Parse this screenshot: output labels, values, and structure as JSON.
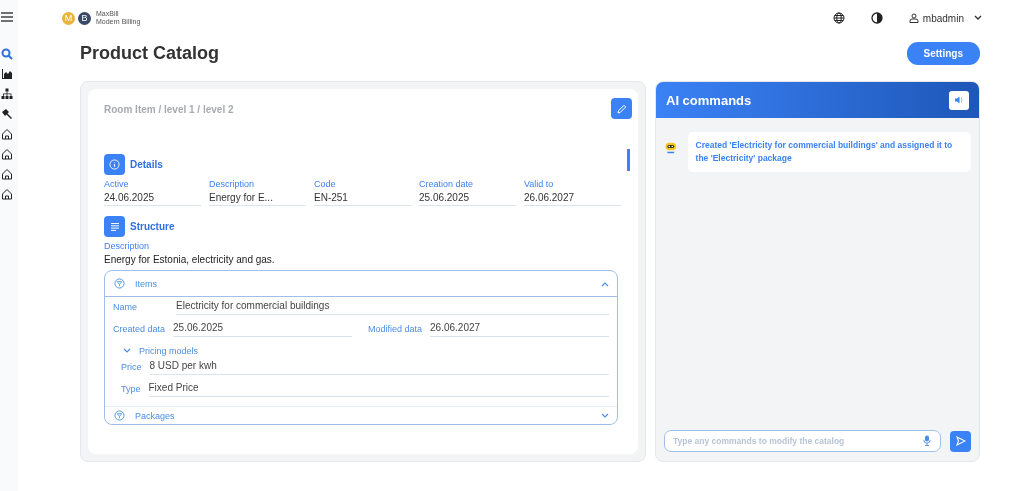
{
  "sidebar": {
    "items": [
      {
        "kind": "search",
        "selected": true
      },
      {
        "kind": "chart",
        "selected": false
      },
      {
        "kind": "hierarchy",
        "selected": false
      },
      {
        "kind": "hammer",
        "selected": false
      },
      {
        "kind": "home",
        "selected": false
      },
      {
        "kind": "home",
        "selected": false
      },
      {
        "kind": "home",
        "selected": false
      },
      {
        "kind": "home",
        "selected": false
      }
    ]
  },
  "logo": {
    "letters": [
      "M",
      "B"
    ],
    "name": "MaxBill",
    "tagline": "Modern Billing"
  },
  "header": {
    "user": "mbadmin"
  },
  "page": {
    "title": "Product Catalog",
    "settings_button": "Settings"
  },
  "catalog": {
    "breadcrumb": "Room Item / level 1 / level 2",
    "details": {
      "title": "Details",
      "fields": [
        {
          "label": "Active",
          "value": "24.06.2025"
        },
        {
          "label": "Description",
          "value": "Energy for E..."
        },
        {
          "label": "Code",
          "value": "EN-251"
        },
        {
          "label": "Creation date",
          "value": "25.06.2025"
        },
        {
          "label": "Valid to",
          "value": "26.06.2027"
        }
      ]
    },
    "structure": {
      "title": "Structure",
      "description_label": "Description",
      "description": "Energy for Estonia, electricity and gas."
    },
    "items": {
      "title": "Items",
      "expanded": true,
      "name_label": "Name",
      "name": "Electricity for commercial buildings",
      "created_label": "Created data",
      "created": "25.06.2025",
      "modified_label": "Modified data",
      "modified": "26.06.2027",
      "pricing": {
        "title": "Pricing models",
        "expanded": true,
        "fields": [
          {
            "label": "Price",
            "value": "8 USD per kwh"
          },
          {
            "label": "Type",
            "value": "Fixed Price"
          }
        ]
      }
    },
    "packages": {
      "title": "Packages",
      "expanded": false
    }
  },
  "ai": {
    "title": "AI commands",
    "messages": [
      "Created 'Electricity for commercial buildings' and assigned it to the 'Electricity' package"
    ],
    "input": {
      "placeholder": "Type any commands to modify the catalog"
    }
  }
}
